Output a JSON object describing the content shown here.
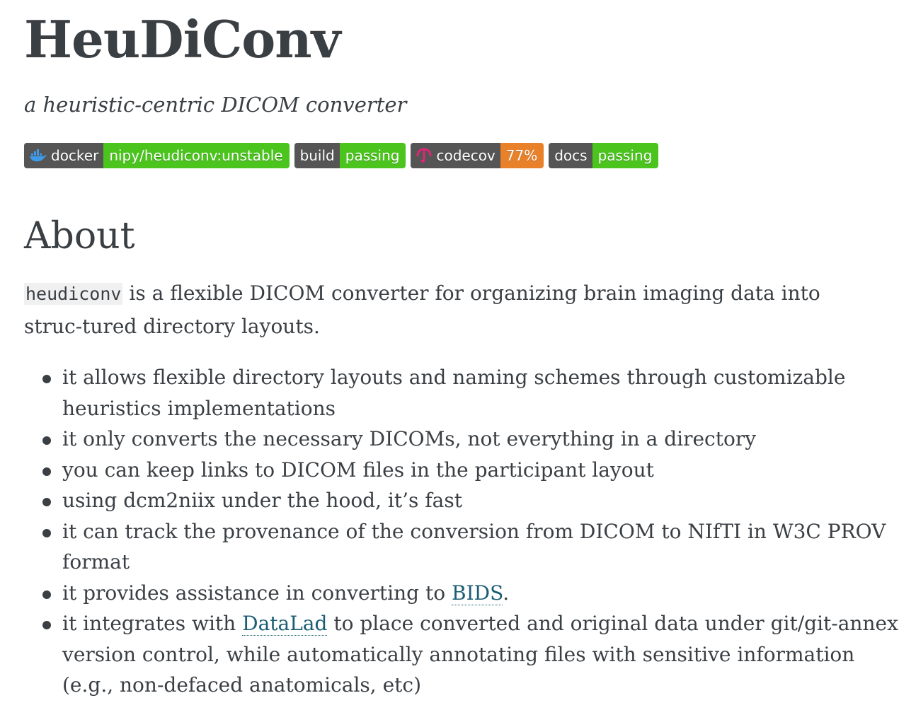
{
  "header": {
    "title": "HeuDiConv",
    "subtitle": "a heuristic-centric DICOM converter"
  },
  "badges": [
    {
      "icon": "docker-whale-icon",
      "label": "docker",
      "value": "nipy/heudiconv:unstable",
      "color": "#4bc51d"
    },
    {
      "label": "build",
      "value": "passing",
      "color": "#4bc51d"
    },
    {
      "icon": "codecov-umbrella-icon",
      "label": "codecov",
      "value": "77%",
      "color": "#e8812a"
    },
    {
      "label": "docs",
      "value": "passing",
      "color": "#4bc51d"
    }
  ],
  "about": {
    "heading": "About",
    "intro_code": "heudiconv",
    "intro_text": " is a flexible DICOM converter for organizing brain imaging data into struc-­tured directory layouts.",
    "features": [
      {
        "text": "it allows flexible directory layouts and naming schemes through customizable heuristics implementations"
      },
      {
        "text": "it only converts the necessary DICOMs, not everything in a directory"
      },
      {
        "text": "you can keep links to DICOM files in the participant layout"
      },
      {
        "text": "using dcm2niix under the hood, it’s fast"
      },
      {
        "text": "it can track the provenance of the conversion from DICOM to NIfTI in W3C PROV format"
      },
      {
        "before": "it provides assistance in converting to ",
        "link": "BIDS",
        "after": "."
      },
      {
        "before": "it integrates with ",
        "link": "DataLad",
        "after": " to place converted and original data under git/git-annex version control, while automatically annotating files with sensitive information (e.g., non-defaced anatomicals, etc)"
      }
    ]
  },
  "colors": {
    "text": "#3a3f44",
    "link": "#1b5e73",
    "badge_dark": "#555555",
    "badge_green": "#4bc51d",
    "badge_orange": "#e8812a"
  }
}
